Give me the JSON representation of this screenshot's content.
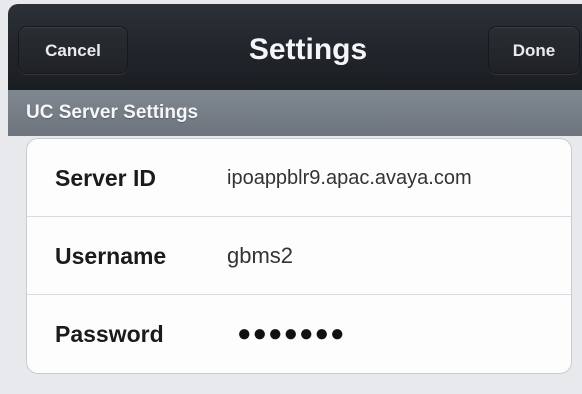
{
  "nav": {
    "cancel_label": "Cancel",
    "title": "Settings",
    "done_label": "Done"
  },
  "section": {
    "header": "UC Server Settings"
  },
  "form": {
    "rows": [
      {
        "label": "Server ID",
        "value": "ipoappblr9.apac.avaya.com"
      },
      {
        "label": "Username",
        "value": "gbms2"
      },
      {
        "label": "Password",
        "value": "●●●●●●●"
      }
    ]
  }
}
